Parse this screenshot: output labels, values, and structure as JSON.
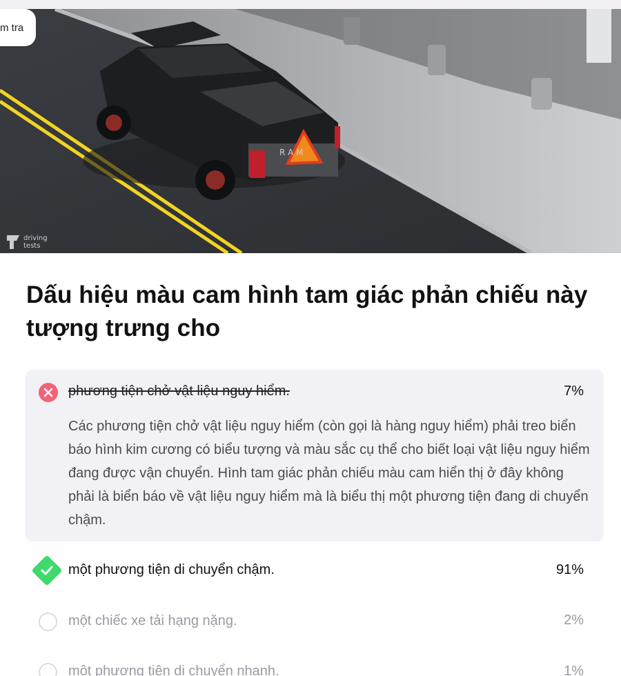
{
  "header": {
    "badge_label": "m tra"
  },
  "image": {
    "watermark_line1": "driving",
    "watermark_line2": "tests",
    "plate_text": "R A M"
  },
  "question": {
    "text": "Dấu hiệu màu cam hình tam giác phản chiếu này tượng trưng cho"
  },
  "answers": [
    {
      "text": "phương tiện chở vật liệu nguy hiểm.",
      "percent": "7%",
      "state": "wrong-selected",
      "explanation": "Các phương tiện chở vật liệu nguy hiểm (còn gọi là hàng nguy hiểm) phải treo biển báo hình kim cương có biểu tượng và màu sắc cụ thể cho biết loại vật liệu nguy hiểm đang được vận chuyển. Hình tam giác phản chiếu màu cam hiển thị ở đây không phải là biển báo về vật liệu nguy hiểm mà là biểu thị một phương tiện đang di chuyển chậm."
    },
    {
      "text": "một phương tiện di chuyển chậm.",
      "percent": "91%",
      "state": "correct"
    },
    {
      "text": "một chiếc xe tải hạng nặng.",
      "percent": "2%",
      "state": "unselected"
    },
    {
      "text": "một phương tiện di chuyển nhanh.",
      "percent": "1%",
      "state": "unselected"
    }
  ],
  "colors": {
    "wrong": "#ef6476",
    "correct": "#3fd96e",
    "wrong_bg": "#f2f1f6",
    "muted_text": "#9b9aa3"
  }
}
